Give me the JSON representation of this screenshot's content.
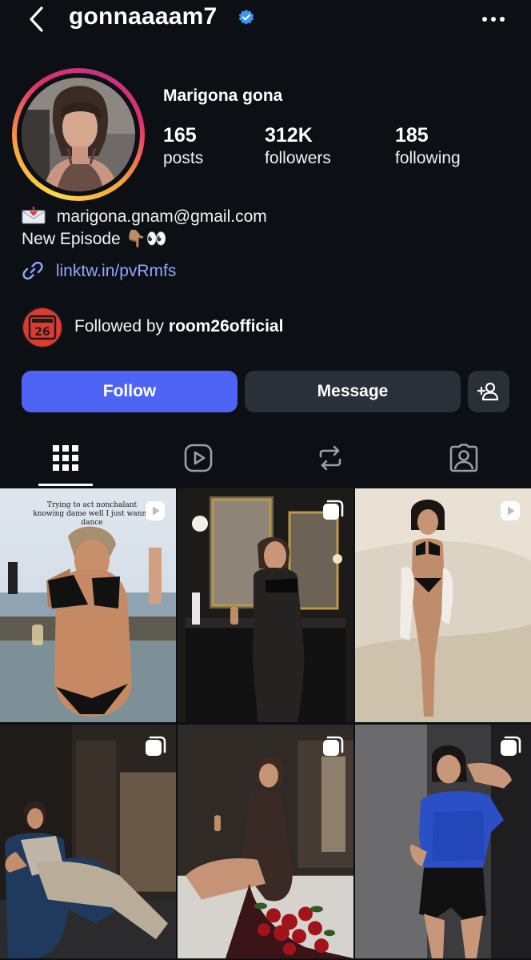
{
  "header": {
    "username": "gonnaaaam7",
    "verified": true,
    "icons": {
      "back": "chevron-left-icon",
      "more": "more-horizontal-icon"
    }
  },
  "profile": {
    "display_name": "Marigona gona",
    "stats": [
      {
        "value": "165",
        "label": "posts"
      },
      {
        "value": "312K",
        "label": "followers"
      },
      {
        "value": "185",
        "label": "following"
      }
    ],
    "bio": {
      "email": "marigona.gnam@gmail.com",
      "episode": "New Episode 👇🏽👀",
      "link": "linktw.in/pvRmfs"
    },
    "followed_by": {
      "prefix": "Followed by",
      "account": "room26official",
      "logo_text": "26"
    }
  },
  "actions": {
    "follow": "Follow",
    "message": "Message"
  },
  "tabs": [
    {
      "name": "posts-grid",
      "icon": "grid-icon",
      "active": true
    },
    {
      "name": "reels",
      "icon": "reels-icon",
      "active": false
    },
    {
      "name": "reposts",
      "icon": "repost-icon",
      "active": false
    },
    {
      "name": "tagged",
      "icon": "tagged-user-icon",
      "active": false
    }
  ],
  "grid": {
    "posts": [
      {
        "type": "reel",
        "caption": "Trying to act nonchalant knowing dame well I just wanna dance"
      },
      {
        "type": "carousel",
        "caption": ""
      },
      {
        "type": "reel",
        "caption": ""
      },
      {
        "type": "carousel",
        "caption": ""
      },
      {
        "type": "carousel",
        "caption": ""
      },
      {
        "type": "carousel",
        "caption": ""
      }
    ]
  },
  "colors": {
    "background": "#0c0f14",
    "follow_button": "#4f63f5",
    "secondary_button": "#2b2f37",
    "link": "#8fa8ff",
    "verified": "#3897f0"
  }
}
